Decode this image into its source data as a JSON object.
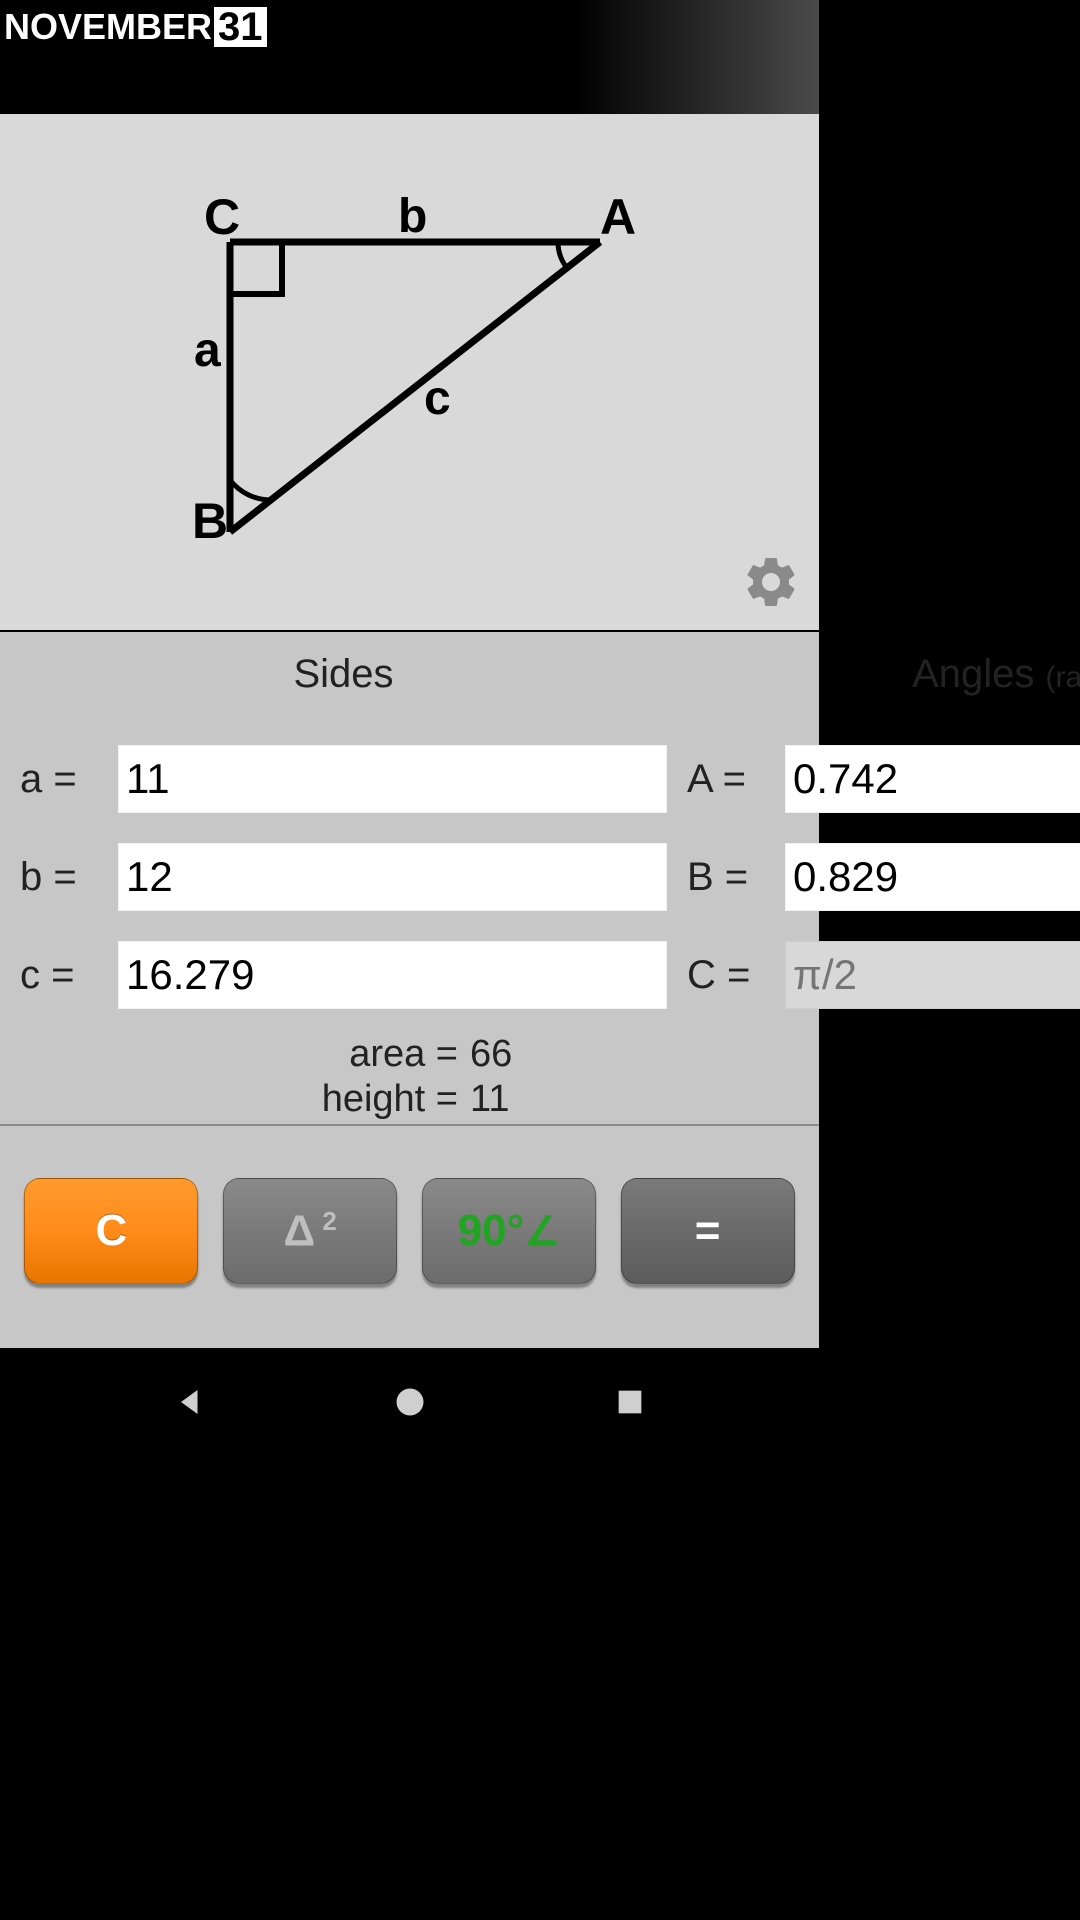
{
  "brand": {
    "month": "NOVEMBER",
    "day": "31"
  },
  "diagram": {
    "labels": {
      "C": "C",
      "b": "b",
      "A": "A",
      "a": "a",
      "c": "c",
      "B": "B"
    }
  },
  "headers": {
    "sides": "Sides",
    "angles": "Angles",
    "angles_unit": "(rad)"
  },
  "sides": {
    "a_label": "a = ",
    "a_value": "11",
    "b_label": "b = ",
    "b_value": "12",
    "c_label": "c = ",
    "c_value": "16.279"
  },
  "angles": {
    "A_label": "A = ",
    "A_value": "0.742",
    "B_label": "B = ",
    "B_value": "0.829",
    "C_label": "C = ",
    "C_placeholder": "π/2"
  },
  "results": {
    "area_label": "area = ",
    "area_value": "66",
    "height_label": "height = ",
    "height_value": "11"
  },
  "buttons": {
    "clear": "C",
    "delta": "Δ",
    "delta_sup": " 2",
    "right_angle": "90°",
    "angle_sym": "∠",
    "equals": "="
  },
  "icons": {
    "gear": "gear-icon",
    "back": "back-icon",
    "home": "home-icon",
    "recent": "recent-icon"
  }
}
